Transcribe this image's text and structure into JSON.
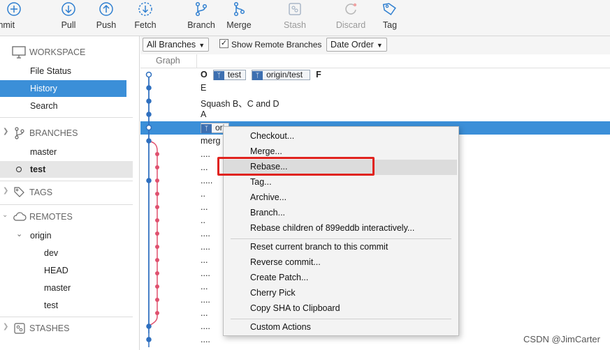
{
  "toolbar": {
    "commit": "Commit",
    "pull": "Pull",
    "push": "Push",
    "fetch": "Fetch",
    "branch": "Branch",
    "merge": "Merge",
    "stash": "Stash",
    "discard": "Discard",
    "tag": "Tag"
  },
  "sidebar": {
    "workspace": "WORKSPACE",
    "file_status": "File Status",
    "history": "History",
    "search": "Search",
    "branches": "BRANCHES",
    "branch_items": [
      "master",
      "test"
    ],
    "tags": "TAGS",
    "remotes": "REMOTES",
    "remote_origin": "origin",
    "remote_items": [
      "dev",
      "HEAD",
      "master",
      "test"
    ],
    "stashes": "STASHES"
  },
  "filters": {
    "branches": "All Branches",
    "show_remote": "Show Remote Branches",
    "order": "Date Order"
  },
  "columns": {
    "graph": "Graph"
  },
  "commits": {
    "r0_tag1": "test",
    "r0_tag2": "origin/test",
    "r0_lead": "O",
    "r0_trail": "F",
    "r1": "E",
    "r2": "Squash B、C and D",
    "r3": "A",
    "r4_tag1": "ori",
    "r5": "merg",
    "dots": [
      "....",
      "...",
      ".....",
      "..",
      "...",
      "..",
      "....",
      "....",
      "...",
      "....",
      "...",
      "....",
      "...",
      "....",
      "....",
      "..."
    ]
  },
  "context_menu": {
    "items": [
      "Checkout...",
      "Merge...",
      "Rebase...",
      "Tag...",
      "Archive...",
      "Branch...",
      "Rebase children of 899eddb interactively..."
    ],
    "items2": [
      "Reset current branch to this commit",
      "Reverse commit...",
      "Create Patch...",
      "Cherry Pick",
      "Copy SHA to Clipboard"
    ],
    "items3": [
      "Custom Actions"
    ]
  },
  "watermark": "CSDN @JimCarter",
  "colors": {
    "accent": "#3b8fd8",
    "branch_line": "#2e6fbf",
    "merge_line": "#e0506e",
    "highlight_box": "#e0231e"
  }
}
